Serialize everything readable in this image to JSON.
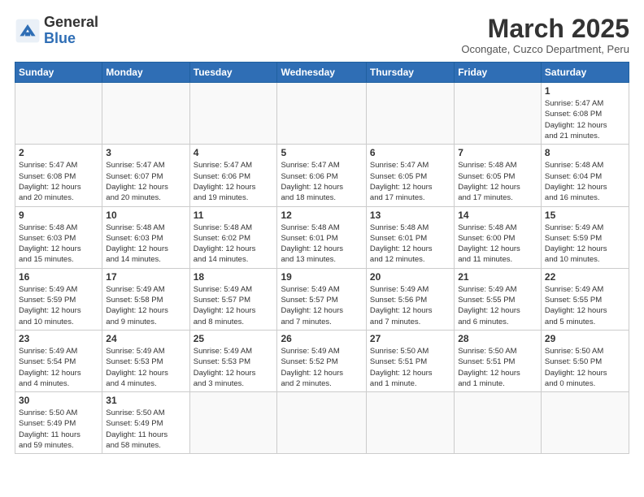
{
  "logo": {
    "text_general": "General",
    "text_blue": "Blue"
  },
  "header": {
    "month_title": "March 2025",
    "subtitle": "Ocongate, Cuzco Department, Peru"
  },
  "weekdays": [
    "Sunday",
    "Monday",
    "Tuesday",
    "Wednesday",
    "Thursday",
    "Friday",
    "Saturday"
  ],
  "days": {
    "d1": {
      "num": "1",
      "info": "Sunrise: 5:47 AM\nSunset: 6:08 PM\nDaylight: 12 hours\nand 21 minutes."
    },
    "d2": {
      "num": "2",
      "info": "Sunrise: 5:47 AM\nSunset: 6:08 PM\nDaylight: 12 hours\nand 20 minutes."
    },
    "d3": {
      "num": "3",
      "info": "Sunrise: 5:47 AM\nSunset: 6:07 PM\nDaylight: 12 hours\nand 20 minutes."
    },
    "d4": {
      "num": "4",
      "info": "Sunrise: 5:47 AM\nSunset: 6:06 PM\nDaylight: 12 hours\nand 19 minutes."
    },
    "d5": {
      "num": "5",
      "info": "Sunrise: 5:47 AM\nSunset: 6:06 PM\nDaylight: 12 hours\nand 18 minutes."
    },
    "d6": {
      "num": "6",
      "info": "Sunrise: 5:47 AM\nSunset: 6:05 PM\nDaylight: 12 hours\nand 17 minutes."
    },
    "d7": {
      "num": "7",
      "info": "Sunrise: 5:48 AM\nSunset: 6:05 PM\nDaylight: 12 hours\nand 17 minutes."
    },
    "d8": {
      "num": "8",
      "info": "Sunrise: 5:48 AM\nSunset: 6:04 PM\nDaylight: 12 hours\nand 16 minutes."
    },
    "d9": {
      "num": "9",
      "info": "Sunrise: 5:48 AM\nSunset: 6:03 PM\nDaylight: 12 hours\nand 15 minutes."
    },
    "d10": {
      "num": "10",
      "info": "Sunrise: 5:48 AM\nSunset: 6:03 PM\nDaylight: 12 hours\nand 14 minutes."
    },
    "d11": {
      "num": "11",
      "info": "Sunrise: 5:48 AM\nSunset: 6:02 PM\nDaylight: 12 hours\nand 14 minutes."
    },
    "d12": {
      "num": "12",
      "info": "Sunrise: 5:48 AM\nSunset: 6:01 PM\nDaylight: 12 hours\nand 13 minutes."
    },
    "d13": {
      "num": "13",
      "info": "Sunrise: 5:48 AM\nSunset: 6:01 PM\nDaylight: 12 hours\nand 12 minutes."
    },
    "d14": {
      "num": "14",
      "info": "Sunrise: 5:48 AM\nSunset: 6:00 PM\nDaylight: 12 hours\nand 11 minutes."
    },
    "d15": {
      "num": "15",
      "info": "Sunrise: 5:49 AM\nSunset: 5:59 PM\nDaylight: 12 hours\nand 10 minutes."
    },
    "d16": {
      "num": "16",
      "info": "Sunrise: 5:49 AM\nSunset: 5:59 PM\nDaylight: 12 hours\nand 10 minutes."
    },
    "d17": {
      "num": "17",
      "info": "Sunrise: 5:49 AM\nSunset: 5:58 PM\nDaylight: 12 hours\nand 9 minutes."
    },
    "d18": {
      "num": "18",
      "info": "Sunrise: 5:49 AM\nSunset: 5:57 PM\nDaylight: 12 hours\nand 8 minutes."
    },
    "d19": {
      "num": "19",
      "info": "Sunrise: 5:49 AM\nSunset: 5:57 PM\nDaylight: 12 hours\nand 7 minutes."
    },
    "d20": {
      "num": "20",
      "info": "Sunrise: 5:49 AM\nSunset: 5:56 PM\nDaylight: 12 hours\nand 7 minutes."
    },
    "d21": {
      "num": "21",
      "info": "Sunrise: 5:49 AM\nSunset: 5:55 PM\nDaylight: 12 hours\nand 6 minutes."
    },
    "d22": {
      "num": "22",
      "info": "Sunrise: 5:49 AM\nSunset: 5:55 PM\nDaylight: 12 hours\nand 5 minutes."
    },
    "d23": {
      "num": "23",
      "info": "Sunrise: 5:49 AM\nSunset: 5:54 PM\nDaylight: 12 hours\nand 4 minutes."
    },
    "d24": {
      "num": "24",
      "info": "Sunrise: 5:49 AM\nSunset: 5:53 PM\nDaylight: 12 hours\nand 4 minutes."
    },
    "d25": {
      "num": "25",
      "info": "Sunrise: 5:49 AM\nSunset: 5:53 PM\nDaylight: 12 hours\nand 3 minutes."
    },
    "d26": {
      "num": "26",
      "info": "Sunrise: 5:49 AM\nSunset: 5:52 PM\nDaylight: 12 hours\nand 2 minutes."
    },
    "d27": {
      "num": "27",
      "info": "Sunrise: 5:50 AM\nSunset: 5:51 PM\nDaylight: 12 hours\nand 1 minute."
    },
    "d28": {
      "num": "28",
      "info": "Sunrise: 5:50 AM\nSunset: 5:51 PM\nDaylight: 12 hours\nand 1 minute."
    },
    "d29": {
      "num": "29",
      "info": "Sunrise: 5:50 AM\nSunset: 5:50 PM\nDaylight: 12 hours\nand 0 minutes."
    },
    "d30": {
      "num": "30",
      "info": "Sunrise: 5:50 AM\nSunset: 5:49 PM\nDaylight: 11 hours\nand 59 minutes."
    },
    "d31": {
      "num": "31",
      "info": "Sunrise: 5:50 AM\nSunset: 5:49 PM\nDaylight: 11 hours\nand 58 minutes."
    }
  }
}
